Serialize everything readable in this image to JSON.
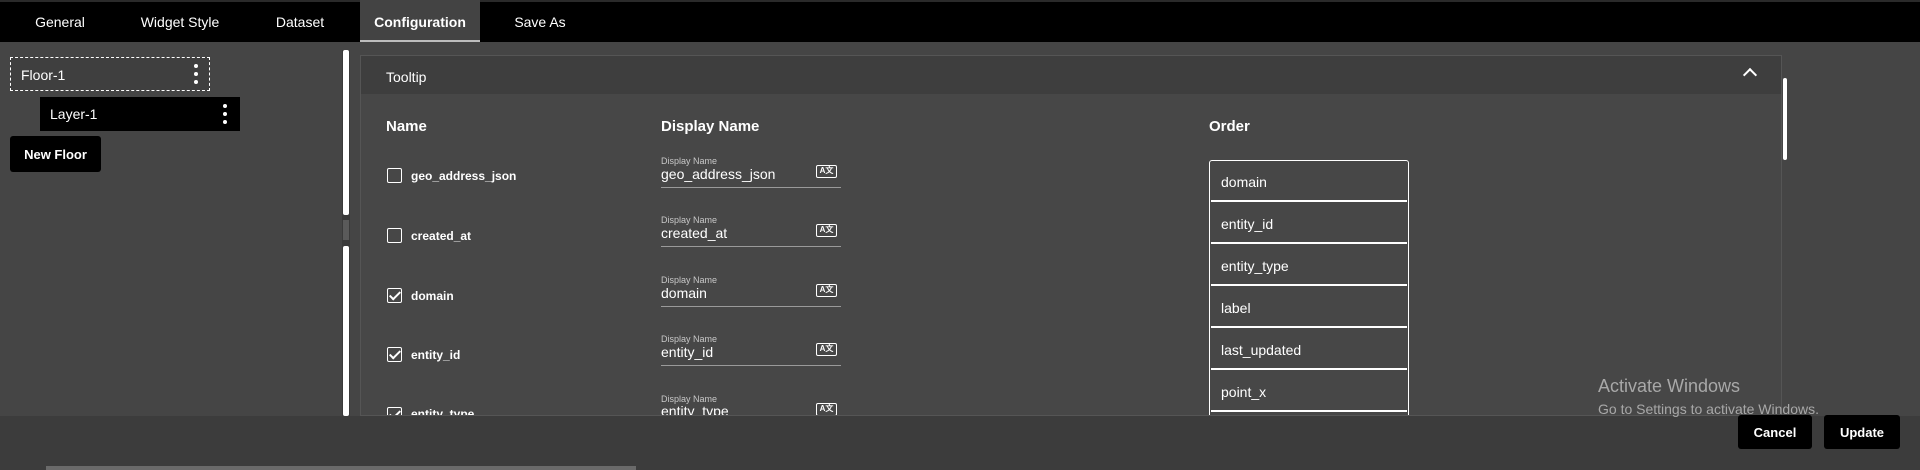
{
  "tabs": [
    {
      "label": "General"
    },
    {
      "label": "Widget Style"
    },
    {
      "label": "Dataset"
    },
    {
      "label": "Configuration",
      "active": true
    },
    {
      "label": "Save As"
    }
  ],
  "floors": {
    "floor_label": "Floor-1",
    "layer_label": "Layer-1",
    "new_floor_label": "New Floor"
  },
  "tooltip": {
    "title": "Tooltip",
    "col_name": "Name",
    "col_display": "Display Name",
    "col_order": "Order",
    "rows": [
      {
        "name": "geo_address_json",
        "checked": false,
        "display_label": "Display Name",
        "display_value": "geo_address_json"
      },
      {
        "name": "created_at",
        "checked": false,
        "display_label": "Display Name",
        "display_value": "created_at"
      },
      {
        "name": "domain",
        "checked": true,
        "display_label": "Display Name",
        "display_value": "domain"
      },
      {
        "name": "entity_id",
        "checked": true,
        "display_label": "Display Name",
        "display_value": "entity_id"
      },
      {
        "name": "entity_type",
        "checked": true,
        "display_label": "Display Name",
        "display_value": "entity_type"
      }
    ],
    "order": [
      "domain",
      "entity_id",
      "entity_type",
      "label",
      "last_updated",
      "point_x"
    ]
  },
  "icons": {
    "display_name_icon": "translate-icon"
  },
  "footer": {
    "cancel_label": "Cancel",
    "update_label": "Update"
  },
  "watermark": {
    "line1": "Activate Windows",
    "line2": "Go to Settings to activate Windows."
  }
}
